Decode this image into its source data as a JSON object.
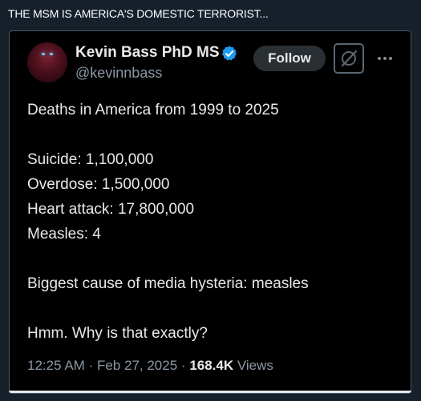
{
  "header": {
    "text": "THE MSM IS AMERICA'S DOMESTIC TERRORIST..."
  },
  "tweet": {
    "author": {
      "display_name": "Kevin Bass PhD MS",
      "handle": "@kevinnbass",
      "verified": true
    },
    "follow_label": "Follow",
    "lines": {
      "l1": "Deaths in America from 1999 to 2025",
      "l2": "Suicide: 1,100,000",
      "l3": "Overdose: 1,500,000",
      "l4": "Heart attack: 17,800,000",
      "l5": "Measles: 4",
      "l6": "Biggest cause of media hysteria: measles",
      "l7": "Hmm. Why is that exactly?"
    },
    "meta": {
      "time": "12:25 AM",
      "separator": "·",
      "date": "Feb 27, 2025",
      "views_count": "168.4K",
      "views_label": "Views"
    }
  },
  "colors": {
    "background": "#15202b",
    "card": "#000000",
    "verified": "#1d9bf0",
    "muted_text": "#8b98a5",
    "primary_text": "#e7e9ea"
  },
  "icons": {
    "verified": "verified-badge-icon",
    "grok": "grok-icon",
    "more": "more-dots-icon"
  }
}
